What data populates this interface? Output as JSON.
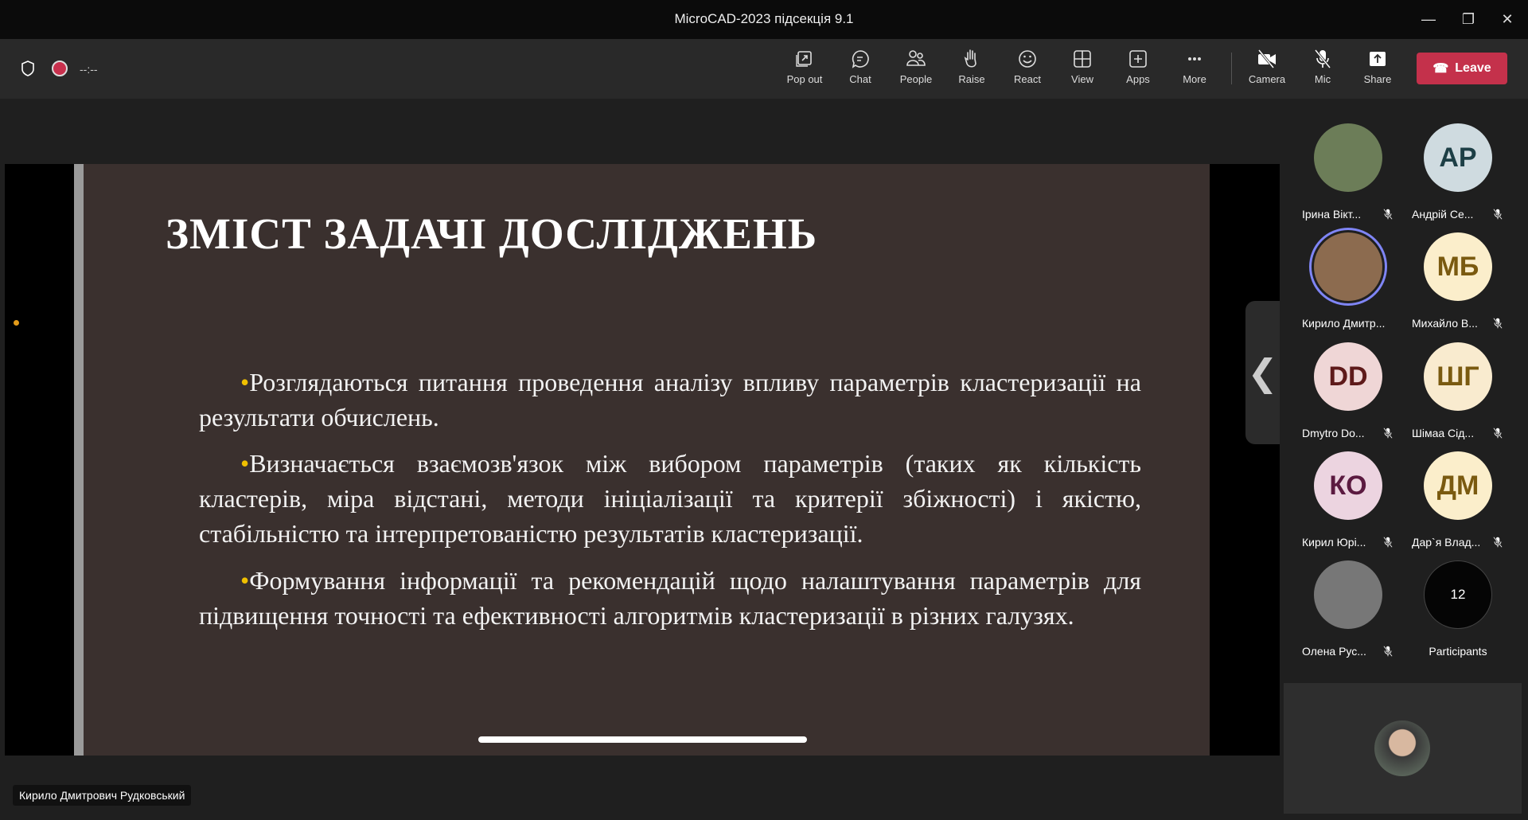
{
  "window": {
    "title": "MicroCAD-2023 підсекція 9.1",
    "minimize": "—",
    "maximize": "❐",
    "close": "✕"
  },
  "toolbar": {
    "timer": "--:--",
    "buttons": [
      {
        "label": "Pop out",
        "icon": "pop-out-icon"
      },
      {
        "label": "Chat",
        "icon": "chat-icon"
      },
      {
        "label": "People",
        "icon": "people-icon"
      },
      {
        "label": "Raise",
        "icon": "raise-hand-icon"
      },
      {
        "label": "React",
        "icon": "react-icon"
      },
      {
        "label": "View",
        "icon": "view-icon"
      },
      {
        "label": "Apps",
        "icon": "apps-icon"
      },
      {
        "label": "More",
        "icon": "more-icon"
      },
      {
        "label": "Camera",
        "icon": "camera-off-icon"
      },
      {
        "label": "Mic",
        "icon": "mic-off-icon"
      },
      {
        "label": "Share",
        "icon": "share-icon"
      }
    ],
    "leave": "Leave",
    "leave_color": "#c4314b"
  },
  "slide": {
    "title": "ЗМІСТ ЗАДАЧІ ДОСЛІДЖЕНЬ",
    "bullets": [
      "Розглядаються питання проведення аналізу впливу параметрів кластеризації на результати обчислень.",
      "Визначається взаємозв'язок між вибором параметрів (таких як кількість кластерів, міра відстані, методи ініціалізації та критерії збіжності) і якістю, стабільністю та інтерпретованістю результатів кластеризації.",
      "Формування інформації та рекомендацій щодо налаштування параметрів для підвищення точності та ефективності алгоритмів кластеризації в різних галузях."
    ],
    "bullet_glyph": "•"
  },
  "participants": [
    {
      "name": "Ірина Вікт...",
      "initials": "",
      "bg": "#6c7d58",
      "fg": "#fff",
      "muted": true
    },
    {
      "name": "Андрій Се...",
      "initials": "АР",
      "bg": "#cfdbe0",
      "fg": "#1d3f46",
      "muted": true
    },
    {
      "name": "Кирило Дмитр...",
      "initials": "",
      "bg": "#8c6b4f",
      "fg": "#fff",
      "muted": false,
      "speaking": true
    },
    {
      "name": "Михайло В...",
      "initials": "МБ",
      "bg": "#fbeecb",
      "fg": "#7a5a10",
      "muted": true
    },
    {
      "name": "Dmytro Do...",
      "initials": "DD",
      "bg": "#efd6d6",
      "fg": "#5e1a1a",
      "muted": true
    },
    {
      "name": "Шімаа Сід...",
      "initials": "ШГ",
      "bg": "#f9ebcf",
      "fg": "#7a5a10",
      "muted": true
    },
    {
      "name": "Кирил Юрі...",
      "initials": "КО",
      "bg": "#ecd4e0",
      "fg": "#5b1a40",
      "muted": true
    },
    {
      "name": "Дар`я Влад...",
      "initials": "ДМ",
      "bg": "#fbeecb",
      "fg": "#7a5a10",
      "muted": true
    },
    {
      "name": "Олена Рус...",
      "initials": "",
      "bg": "#777",
      "fg": "#fff",
      "muted": true
    },
    {
      "name": "Participants",
      "initials": "12",
      "bg": "#050505",
      "fg": "#fff",
      "muted": false
    }
  ],
  "speaker_label": "Кирило Дмитрович Рудковський",
  "collapse": "❮"
}
